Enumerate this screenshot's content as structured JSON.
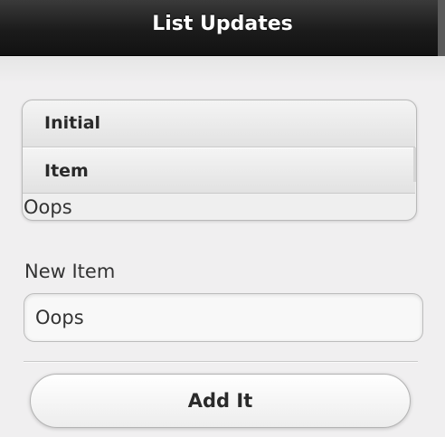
{
  "header": {
    "title": "List Updates"
  },
  "list": {
    "items": [
      {
        "label": "Initial"
      },
      {
        "label": "Item"
      }
    ],
    "stray_text": "Oops"
  },
  "form": {
    "new_item_label": "New Item",
    "new_item_value": "Oops",
    "add_button_label": "Add It"
  }
}
